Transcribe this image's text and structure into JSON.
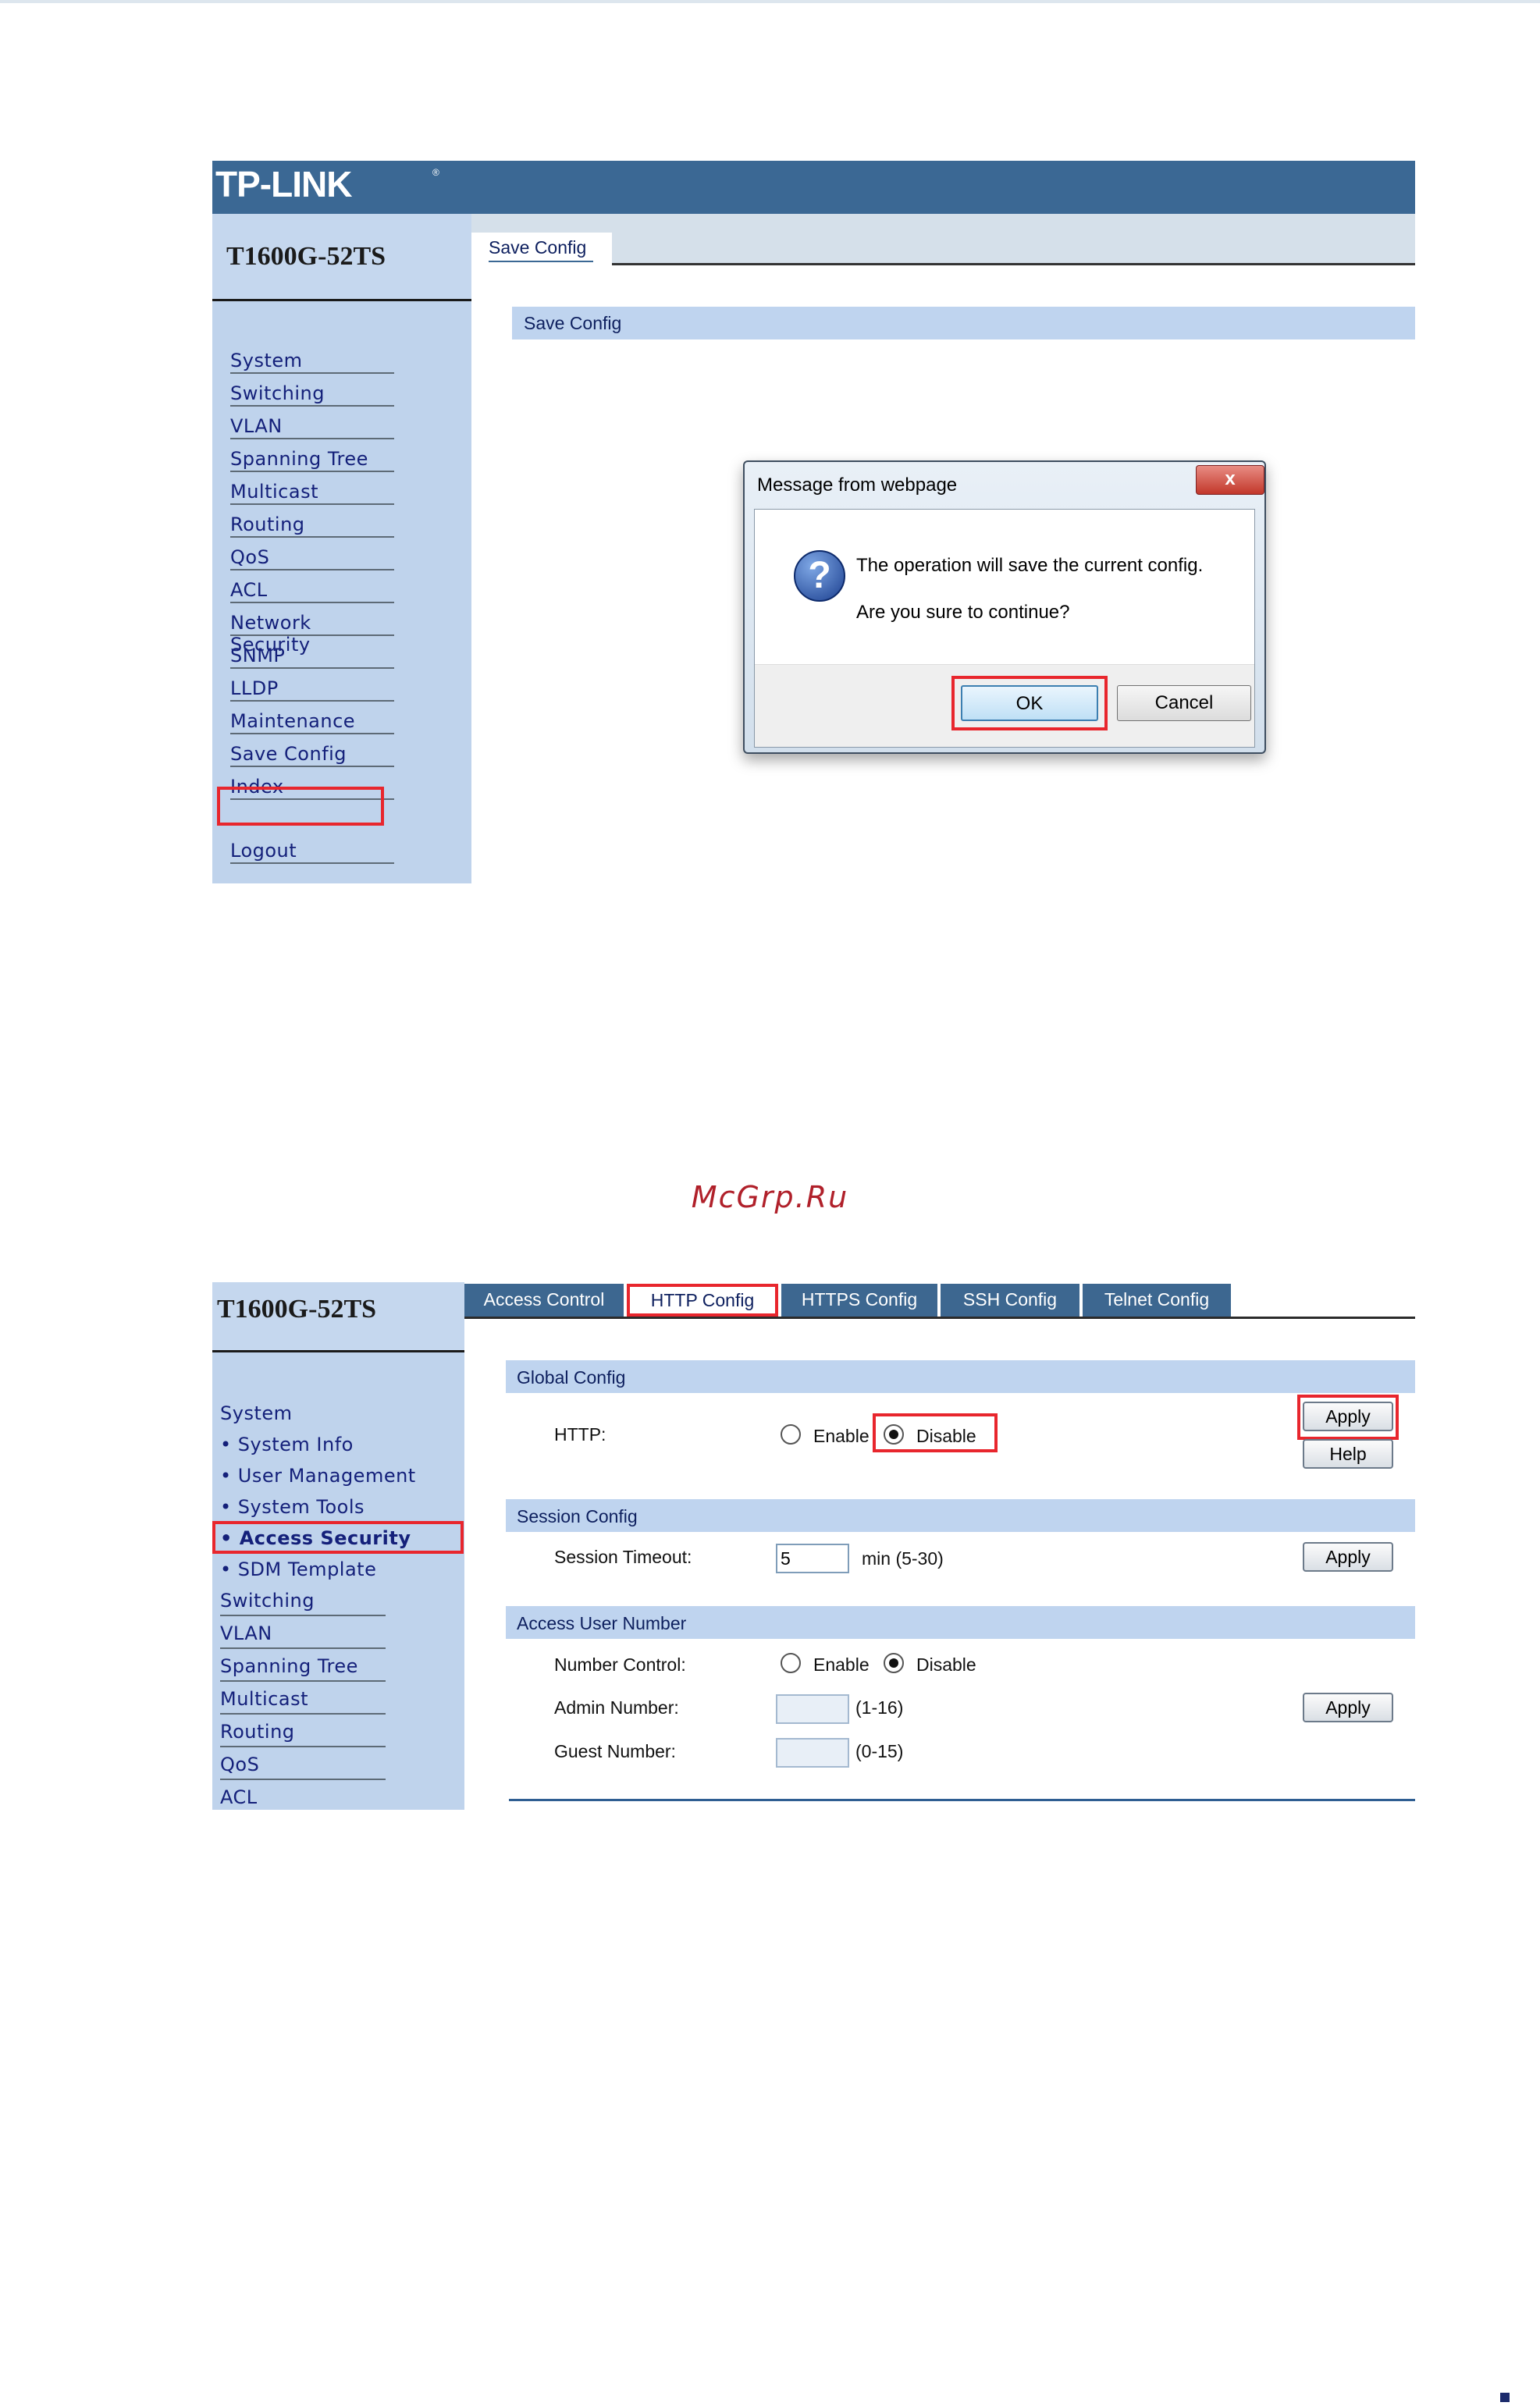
{
  "screenshot1": {
    "brand": "TP-LINK",
    "brand_mark": "®",
    "model": "T1600G-52TS",
    "menu": [
      "System",
      "Switching",
      "VLAN",
      "Spanning Tree",
      "Multicast",
      "Routing",
      "QoS",
      "ACL",
      "Network Security",
      "SNMP",
      "LLDP",
      "Maintenance",
      "Save Config",
      "Index",
      "Logout"
    ],
    "tab": "Save Config",
    "section": "Save Config",
    "dialog": {
      "title": "Message from webpage",
      "close": "x",
      "icon": "?",
      "line1": "The operation will save the current config.",
      "line2": "Are you sure to continue?",
      "ok": "OK",
      "cancel": "Cancel"
    }
  },
  "watermark": "McGrp.Ru",
  "screenshot2": {
    "model": "T1600G-52TS",
    "menu": [
      "System",
      "• System Info",
      "• User Management",
      "• System Tools",
      "• Access Security",
      "• SDM Template",
      "Switching",
      "VLAN",
      "Spanning Tree",
      "Multicast",
      "Routing",
      "QoS",
      "ACL"
    ],
    "tabs": [
      "Access Control",
      "HTTP Config",
      "HTTPS Config",
      "SSH Config",
      "Telnet Config"
    ],
    "global_config": {
      "title": "Global Config",
      "http_label": "HTTP:",
      "enable": "Enable",
      "disable": "Disable",
      "selected": "Disable",
      "apply": "Apply",
      "help": "Help"
    },
    "session_config": {
      "title": "Session Config",
      "timeout_label": "Session Timeout:",
      "timeout_value": "5",
      "timeout_unit": "min (5-30)",
      "apply": "Apply"
    },
    "access_user_number": {
      "title": "Access User Number",
      "number_control_label": "Number Control:",
      "enable": "Enable",
      "disable": "Disable",
      "selected": "Disable",
      "admin_label": "Admin Number:",
      "admin_range": "(1-16)",
      "guest_label": "Guest Number:",
      "guest_range": "(0-15)",
      "apply": "Apply"
    }
  }
}
